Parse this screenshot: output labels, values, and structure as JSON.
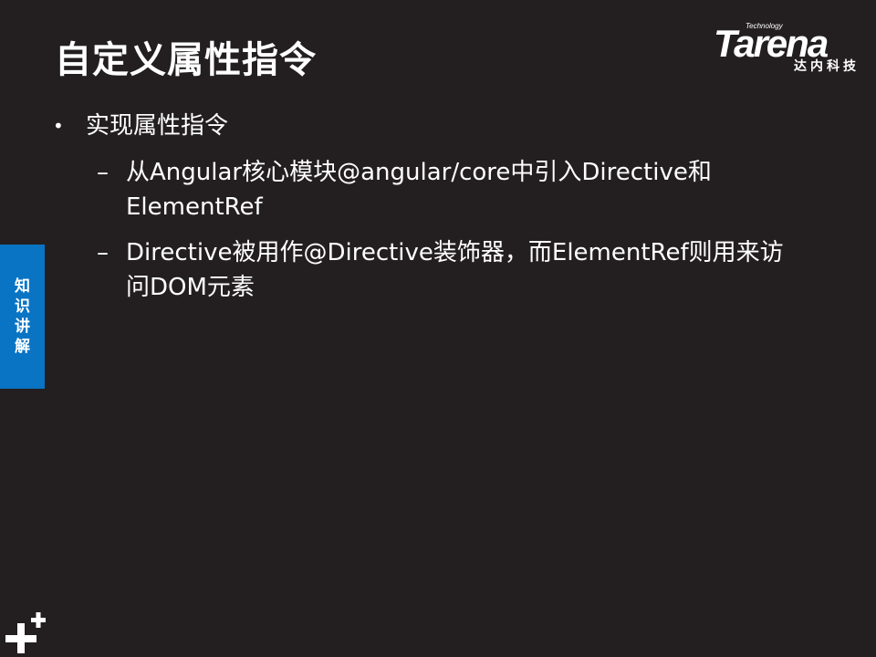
{
  "slide": {
    "title": "自定义属性指令",
    "logo": {
      "small_text": "Technology",
      "brand_text": "Tarena",
      "chinese_text": "达内科技"
    },
    "bullet": {
      "marker": "•",
      "text": "实现属性指令"
    },
    "sub_items": [
      {
        "marker": "–",
        "text": "从Angular核心模块@angular/core中引入Directive和ElementRef"
      },
      {
        "marker": "–",
        "text": "Directive被用作@Directive装饰器，而ElementRef则用来访问DOM元素"
      }
    ],
    "side_tab": {
      "chars": [
        "知",
        "识",
        "讲",
        "解"
      ],
      "color": "#0a74c4"
    },
    "corner_icon": "plus-plus-icon",
    "background_color": "#231f20"
  }
}
